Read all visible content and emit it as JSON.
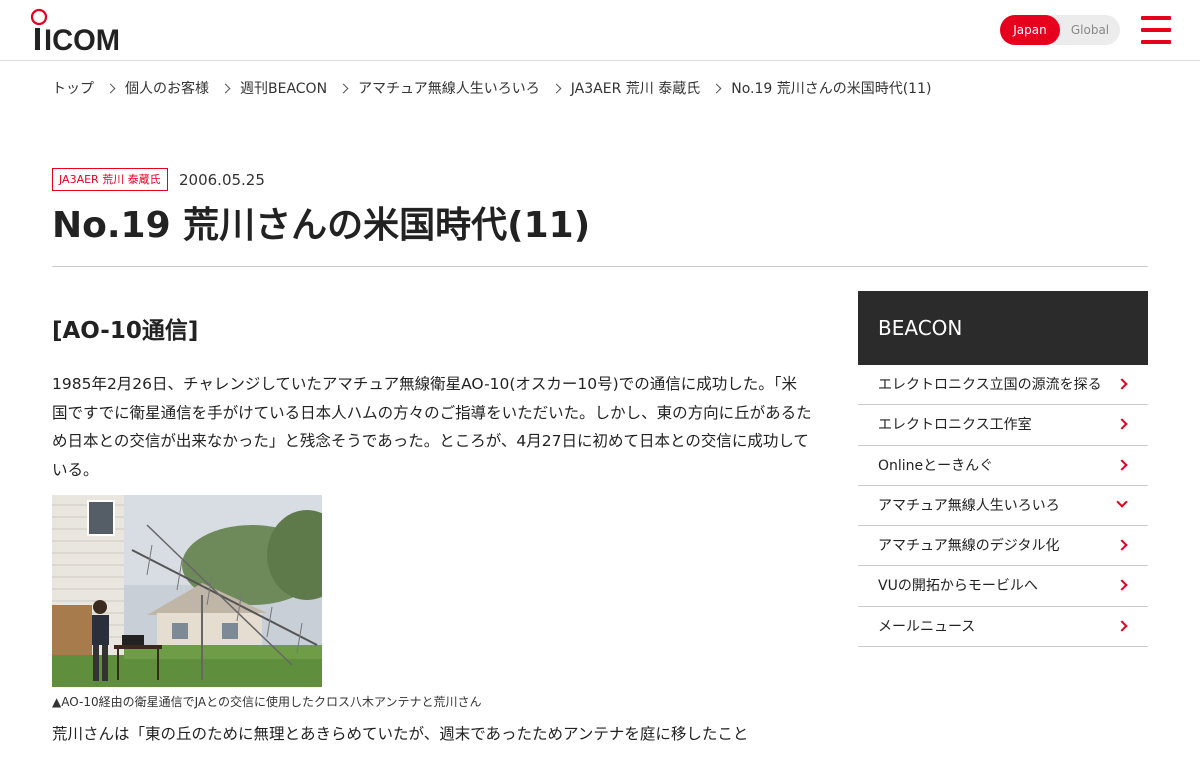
{
  "header": {
    "logo_text": "ICOM",
    "lang_japan": "Japan",
    "lang_global": "Global"
  },
  "breadcrumb": [
    "トップ",
    "個人のお客様",
    "週刊BEACON",
    "アマチュア無線人生いろいろ",
    "JA3AER 荒川 泰蔵氏",
    "No.19 荒川さんの米国時代(11)"
  ],
  "article": {
    "tag": "JA3AER 荒川 泰蔵氏",
    "date": "2006.05.25",
    "title": "No.19 荒川さんの米国時代(11)",
    "section_heading": "[AO-10通信]",
    "paragraph1": "1985年2月26日、チャレンジしていたアマチュア無線衛星AO-10(オスカー10号)での通信に成功した。「米国ですでに衛星通信を手がけている日本人ハムの方々のご指導をいただいた。しかし、東の方向に丘があるため日本との交信が出来なかった」と残念そうであった。ところが、4月27日に初めて日本との交信に成功している。",
    "caption": "▲AO-10経由の衛星通信でJAとの交信に使用したクロス八木アンテナと荒川さん",
    "paragraph2": "荒川さんは「東の丘のために無理とあきらめていたが、週末であったためアンテナを庭に移したこと"
  },
  "sidebar": {
    "title": "BEACON",
    "items": [
      {
        "label": "エレクトロニクス立国の源流を探る"
      },
      {
        "label": "エレクトロニクス工作室"
      },
      {
        "label": "Onlineとーきんぐ"
      },
      {
        "label": "アマチュア無線人生いろいろ"
      },
      {
        "label": "アマチュア無線のデジタル化"
      },
      {
        "label": "VUの開拓からモービルへ"
      },
      {
        "label": "メールニュース"
      }
    ]
  },
  "colors": {
    "brand_red": "#e6001e",
    "sidebar_header_bg": "#2b2b2b"
  }
}
